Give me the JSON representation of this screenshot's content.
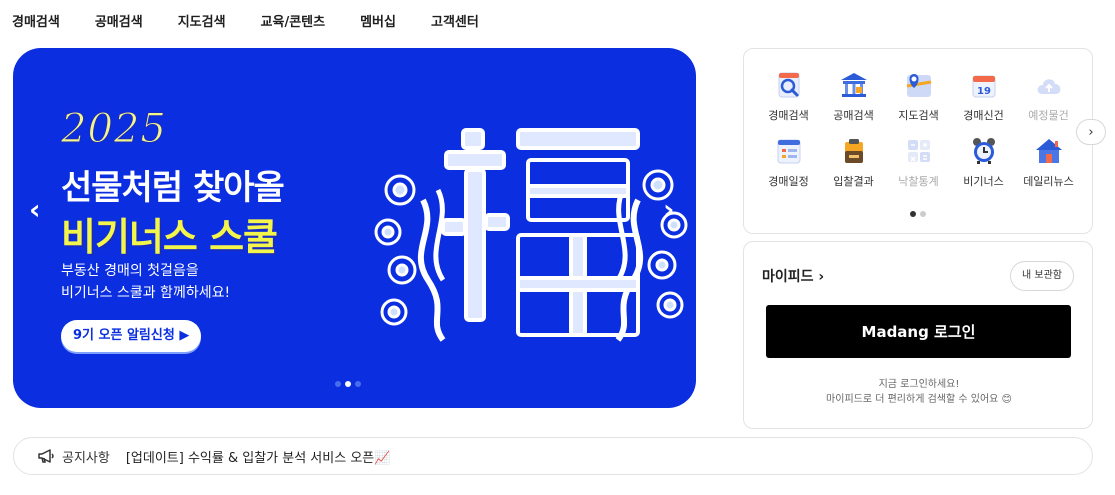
{
  "nav": {
    "items": [
      {
        "label": "경매검색"
      },
      {
        "label": "공매검색"
      },
      {
        "label": "지도검색"
      },
      {
        "label": "교육/콘텐츠"
      },
      {
        "label": "멤버십"
      },
      {
        "label": "고객센터"
      }
    ]
  },
  "banner": {
    "year": "2025",
    "headline": "선물처럼 찾아올",
    "headline2": "비기너스 스쿨",
    "sub_line1": "부동산 경매의 첫걸음을",
    "sub_line2": "비기너스 스쿨과 함께하세요!",
    "cta": "9기 오픈 알림신청 ▶",
    "left_arrow": "‹",
    "right_arrow": "›",
    "page_count": 3,
    "current_page": 2,
    "background": "#0a2ee0"
  },
  "quick_menu": {
    "items": [
      {
        "label": "경매검색",
        "icon": "magnifier-document-icon",
        "enabled": true
      },
      {
        "label": "공매검색",
        "icon": "government-building-icon",
        "enabled": true
      },
      {
        "label": "지도검색",
        "icon": "map-pin-icon",
        "enabled": true
      },
      {
        "label": "경매신건",
        "icon": "calendar-19-icon",
        "enabled": true
      },
      {
        "label": "예정물건",
        "icon": "cloud-upload-icon",
        "enabled": false
      },
      {
        "label": "경매일정",
        "icon": "schedule-list-icon",
        "enabled": true
      },
      {
        "label": "입찰결과",
        "icon": "clipboard-result-icon",
        "enabled": true
      },
      {
        "label": "낙찰통계",
        "icon": "statistics-grid-icon",
        "enabled": false
      },
      {
        "label": "비기너스",
        "icon": "alarm-clock-icon",
        "enabled": true
      },
      {
        "label": "데일리뉴스",
        "icon": "house-news-icon",
        "enabled": true
      }
    ],
    "next_label": "›",
    "page_count": 2,
    "current_page": 1
  },
  "mypage": {
    "title": "마이피드 ›",
    "saved_button": "내 보관함",
    "login_button": "Madang 로그인",
    "message_line1": "지금 로그인하세요!",
    "message_line2": "마이피드로 더 편리하게 검색할 수 있어요 😊"
  },
  "notice": {
    "icon": "megaphone-icon",
    "label": "공지사항",
    "text": "[업데이트] 수익률 & 입찰가 분석 서비스 오픈📈"
  }
}
